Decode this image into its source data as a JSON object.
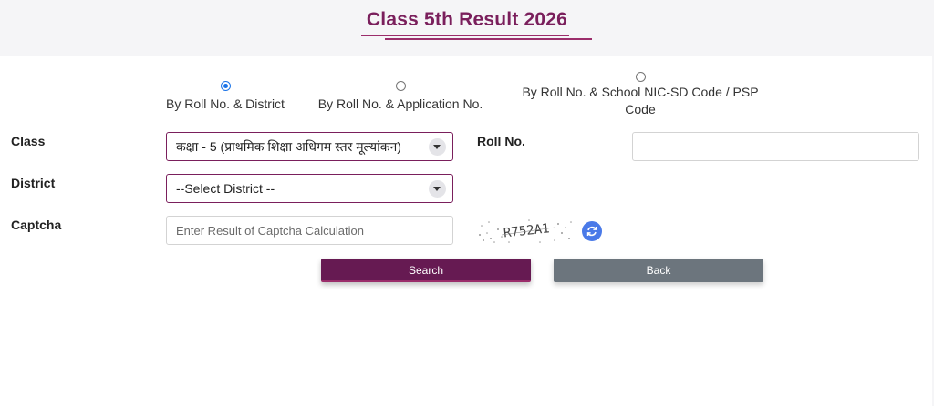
{
  "page": {
    "title": "Class 5th Result 2026"
  },
  "search_mode": {
    "options": [
      {
        "label": "By Roll No. & District",
        "selected": true
      },
      {
        "label": "By Roll No. & Application No.",
        "selected": false
      },
      {
        "label": "By Roll No. & School NIC-SD Code / PSP Code",
        "selected": false
      }
    ]
  },
  "form": {
    "class_label": "Class",
    "class_value": "कक्षा - 5 (प्राथमिक शिक्षा अधिगम स्तर मूल्यांकन)",
    "roll_label": "Roll No.",
    "roll_value": "",
    "district_label": "District",
    "district_value": "--Select District --",
    "captcha_label": "Captcha",
    "captcha_placeholder": "Enter Result of Captcha Calculation",
    "captcha_text": "R752A1"
  },
  "buttons": {
    "search": "Search",
    "back": "Back"
  },
  "colors": {
    "brand": "#7a1f5c",
    "search_button": "#661a52",
    "back_button": "#6c757d",
    "radio_selected": "#1a73e8",
    "refresh_icon": "#4a7ae8"
  },
  "icons": {
    "dropdown": "chevron-down-icon",
    "refresh": "refresh-icon"
  }
}
